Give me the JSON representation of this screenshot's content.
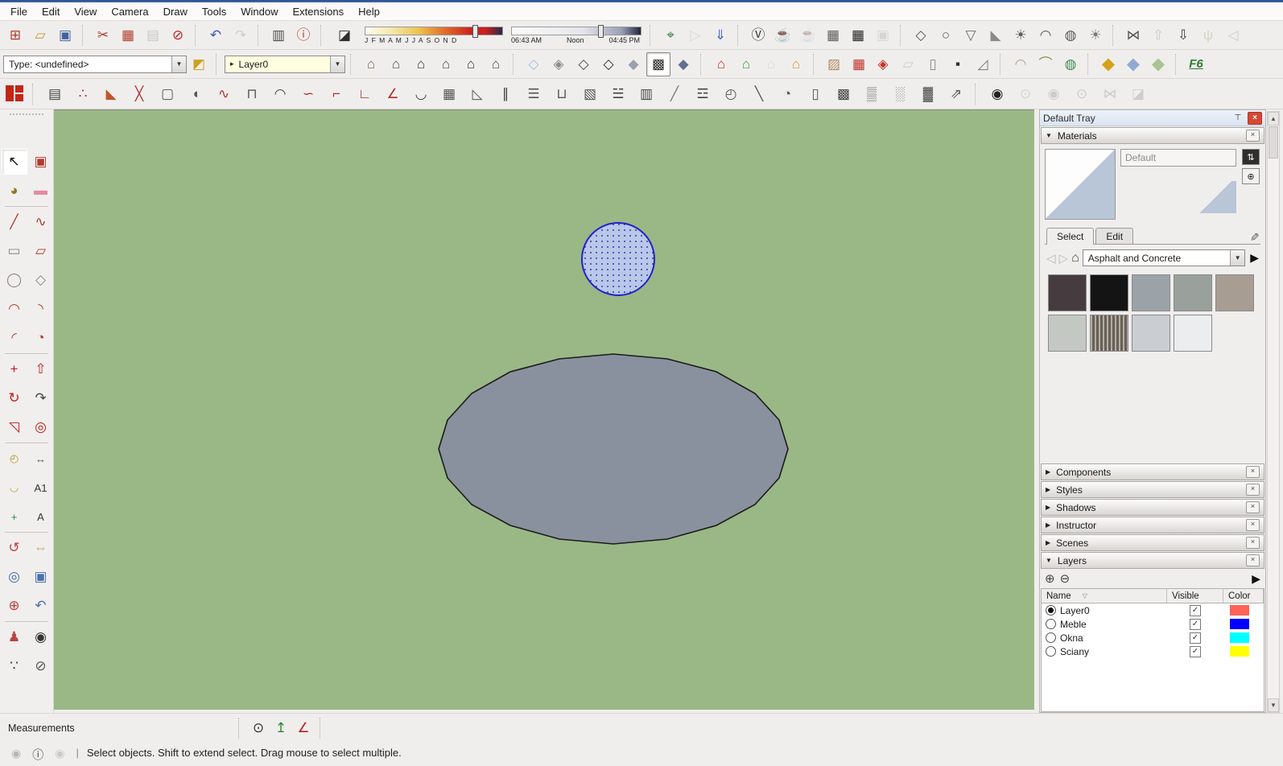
{
  "menu": {
    "items": [
      {
        "label": "File",
        "name": "menu-file"
      },
      {
        "label": "Edit",
        "name": "menu-edit"
      },
      {
        "label": "View",
        "name": "menu-view"
      },
      {
        "label": "Camera",
        "name": "menu-camera"
      },
      {
        "label": "Draw",
        "name": "menu-draw"
      },
      {
        "label": "Tools",
        "name": "menu-tools"
      },
      {
        "label": "Window",
        "name": "menu-window"
      },
      {
        "label": "Extensions",
        "name": "menu-extensions"
      },
      {
        "label": "Help",
        "name": "menu-help"
      }
    ]
  },
  "toolbars": {
    "row1": {
      "g1": [
        {
          "name": "new-button",
          "glyph": "⊞",
          "color": "#b23a2e"
        },
        {
          "name": "open-button",
          "glyph": "▱",
          "color": "#c89a2a"
        },
        {
          "name": "save-button",
          "glyph": "▣",
          "color": "#44639e"
        }
      ],
      "g2": [
        {
          "name": "cut-button",
          "glyph": "✂",
          "color": "#b23a2e"
        },
        {
          "name": "copy-button",
          "glyph": "▦",
          "color": "#b23a2e"
        },
        {
          "name": "paste-button",
          "glyph": "▤",
          "color": "#8a8a8a",
          "faded": true
        },
        {
          "name": "erase-button",
          "glyph": "⊘",
          "color": "#c41f1f"
        }
      ],
      "g3": [
        {
          "name": "undo-button",
          "glyph": "↶",
          "color": "#3b5fc0"
        },
        {
          "name": "redo-button",
          "glyph": "↷",
          "color": "#9a9a9a",
          "faded": true
        }
      ],
      "g4": [
        {
          "name": "print-button",
          "glyph": "▥",
          "color": "#4a4a4a"
        },
        {
          "name": "model-info-button",
          "glyph": "ⓘ",
          "color": "#b23a2e"
        }
      ],
      "shadows": {
        "toggle_name": "toggle-shadows-button",
        "months": "J F M A M J J A S O N D",
        "time_start": "06:43 AM",
        "time_mid": "Noon",
        "time_end": "04:45 PM"
      },
      "g6": [
        {
          "name": "add-location-button",
          "glyph": "⌖",
          "color": "#3e7d3e"
        },
        {
          "name": "toggle-terrain-button",
          "glyph": "▷",
          "color": "#b3b3b3",
          "faded": true
        },
        {
          "name": "add-building-button",
          "glyph": "⇓",
          "color": "#3a6ac8"
        }
      ],
      "g7": [
        {
          "name": "vray-render-button",
          "glyph": "Ⓥ",
          "color": "#3c3c3c"
        },
        {
          "name": "vray-asset-editor-button",
          "glyph": "☕",
          "color": "#3c3c3c"
        },
        {
          "name": "vray-interactive-button",
          "glyph": "☕",
          "color": "#adadad",
          "faded": true
        },
        {
          "name": "vray-frame-buffer-button",
          "glyph": "▦",
          "color": "#5a5a5a"
        },
        {
          "name": "vray-batch-render-button",
          "glyph": "▦",
          "color": "#1e1e1e"
        },
        {
          "name": "vray-lock-camera-button",
          "glyph": "▣",
          "color": "#b0b0b0",
          "faded": true
        }
      ],
      "g8": [
        {
          "name": "vray-rectangle-light-button",
          "glyph": "◇",
          "color": "#565656"
        },
        {
          "name": "vray-sphere-light-button",
          "glyph": "○",
          "color": "#565656"
        },
        {
          "name": "vray-spot-light-button",
          "glyph": "▽",
          "color": "#6a6a6a"
        },
        {
          "name": "vray-ies-light-button",
          "glyph": "◣",
          "color": "#8a8a8a"
        },
        {
          "name": "vray-omni-light-button",
          "glyph": "☀",
          "color": "#5a5a5a"
        },
        {
          "name": "vray-dome-light-button",
          "glyph": "◠",
          "color": "#565656"
        },
        {
          "name": "vray-mesh-light-button",
          "glyph": "◍",
          "color": "#5a5a5a"
        },
        {
          "name": "vray-ambient-light-button",
          "glyph": "☀",
          "color": "#7a7a7a"
        }
      ],
      "g9": [
        {
          "name": "vray-infinite-plane-button",
          "glyph": "⋈",
          "color": "#555555"
        },
        {
          "name": "vray-import-proxy-button",
          "glyph": "⇧",
          "color": "#9a9a9a",
          "faded": true
        },
        {
          "name": "vray-export-proxy-button",
          "glyph": "⇩",
          "color": "#3e3e3e"
        },
        {
          "name": "vray-fur-button",
          "glyph": "ψ",
          "color": "#9fb387",
          "faded": true
        },
        {
          "name": "vray-clipper-button",
          "glyph": "◁",
          "color": "#9a9a9a",
          "faded": true
        }
      ]
    },
    "row2": {
      "type_combo": "Type: <undefined>",
      "tag_icon_name": "entity-tags-icon",
      "layer_combo": "Layer0",
      "views": [
        {
          "name": "view-iso-button",
          "glyph": "⌂",
          "color": "#7b6347"
        },
        {
          "name": "view-top-button",
          "glyph": "⌂",
          "color": "#4a4a4a"
        },
        {
          "name": "view-front-button",
          "glyph": "⌂",
          "color": "#333333"
        },
        {
          "name": "view-right-button",
          "glyph": "⌂",
          "color": "#4a4a4a"
        },
        {
          "name": "view-back-button",
          "glyph": "⌂",
          "color": "#333333"
        },
        {
          "name": "view-left-button",
          "glyph": "⌂",
          "color": "#4a4a4a"
        }
      ],
      "styles": [
        {
          "name": "style-xray-button",
          "glyph": "◇",
          "color": "#9cc3e0"
        },
        {
          "name": "style-back-edges-button",
          "glyph": "◈",
          "color": "#8a8a8a"
        },
        {
          "name": "style-wireframe-button",
          "glyph": "◇",
          "color": "#4a4a4a"
        },
        {
          "name": "style-hidden-line-button",
          "glyph": "◇",
          "color": "#2e2e2e"
        },
        {
          "name": "style-shaded-button",
          "glyph": "◆",
          "color": "#98a1ac"
        },
        {
          "name": "style-shaded-textures-button",
          "glyph": "▩",
          "color": "#2b2b2b",
          "pressed": true
        },
        {
          "name": "style-monochrome-button",
          "glyph": "◆",
          "color": "#5f7090"
        }
      ],
      "extA": [
        {
          "name": "house-builder-button",
          "glyph": "⌂",
          "color": "#c03028"
        },
        {
          "name": "house-update-button",
          "glyph": "⌂",
          "color": "#3f9b3f"
        },
        {
          "name": "house-sync-button",
          "glyph": "⌂",
          "color": "#b8b8b8",
          "faded": true
        },
        {
          "name": "house-report-button",
          "glyph": "⌂",
          "color": "#cf9f1f"
        }
      ],
      "extB": [
        {
          "name": "texture-plane-button",
          "glyph": "▨",
          "color": "#b08a60"
        },
        {
          "name": "grid-tool-button",
          "glyph": "▦",
          "color": "#c03028"
        }
      ],
      "extC": [
        {
          "name": "flip-tool-button",
          "glyph": "◈",
          "color": "#c03028"
        },
        {
          "name": "crumple-tool-button",
          "glyph": "▱",
          "color": "#9a9a9a",
          "faded": true
        },
        {
          "name": "ghost-tool-button",
          "glyph": "▯",
          "color": "#8a8a8a"
        },
        {
          "name": "shadow-box-button",
          "glyph": "▪",
          "color": "#2f2f2f"
        },
        {
          "name": "slice-tool-button",
          "glyph": "◿",
          "color": "#777777"
        }
      ],
      "extD": [
        {
          "name": "shell-tool-button",
          "glyph": "◠",
          "color": "#ada282"
        },
        {
          "name": "curve-box-button",
          "glyph": "⌒",
          "color": "#7d9b3f"
        },
        {
          "name": "geodesic-tool-button",
          "glyph": "◍",
          "color": "#3f8f55"
        }
      ],
      "cubes": [
        {
          "name": "cube-yellow-button",
          "glyph": "◆",
          "color": "#d5a21b"
        },
        {
          "name": "cube-blue-button",
          "glyph": "◆",
          "color": "#92a9d4"
        },
        {
          "name": "cube-green-button",
          "glyph": "◆",
          "color": "#a9c492"
        }
      ],
      "f6_label": "F6"
    },
    "row3": {
      "bit": [
        {
          "name": "wall-panel-tool",
          "glyph": "▤",
          "color": "#3f3f3f"
        },
        {
          "name": "bead-chain-tool",
          "glyph": "∴",
          "color": "#b03030"
        },
        {
          "name": "roof-pyramid-tool",
          "glyph": "◣",
          "color": "#c0552a"
        },
        {
          "name": "cut-cross-tool",
          "glyph": "╳",
          "color": "#b03030"
        },
        {
          "name": "dashed-face-tool",
          "glyph": "▢",
          "color": "#555555"
        },
        {
          "name": "extrude-tool",
          "glyph": "◖",
          "color": "#555555"
        },
        {
          "name": "curl-tool",
          "glyph": "∿",
          "color": "#b03030"
        },
        {
          "name": "frame-box-tool",
          "glyph": "⊓",
          "color": "#555555"
        },
        {
          "name": "dome-tool",
          "glyph": "◠",
          "color": "#444444"
        },
        {
          "name": "hook-tool",
          "glyph": "∽",
          "color": "#b03030"
        },
        {
          "name": "corner-a-tool",
          "glyph": "⌐",
          "color": "#b03030"
        },
        {
          "name": "corner-b-tool",
          "glyph": "∟",
          "color": "#b03030"
        },
        {
          "name": "angle-tool",
          "glyph": "∠",
          "color": "#b03030"
        },
        {
          "name": "arc-profile-tool",
          "glyph": "◡",
          "color": "#444444"
        },
        {
          "name": "cage-tool",
          "glyph": "▦",
          "color": "#555555"
        },
        {
          "name": "wedge-tool",
          "glyph": "◺",
          "color": "#555555"
        },
        {
          "name": "column-tool",
          "glyph": "∥",
          "color": "#444444"
        },
        {
          "name": "fence-tool",
          "glyph": "☰",
          "color": "#555555"
        },
        {
          "name": "grab-frame-tool",
          "glyph": "⊔",
          "color": "#555555"
        },
        {
          "name": "fold-tool",
          "glyph": "▧",
          "color": "#555555"
        },
        {
          "name": "louvre-tool",
          "glyph": "☱",
          "color": "#444444"
        },
        {
          "name": "shelf-tool",
          "glyph": "▥",
          "color": "#444444"
        },
        {
          "name": "plank-tool",
          "glyph": "╱",
          "color": "#777777"
        },
        {
          "name": "stairs-tool",
          "glyph": "☲",
          "color": "#444444"
        },
        {
          "name": "spiral-stairs-tool",
          "glyph": "◴",
          "color": "#555555"
        },
        {
          "name": "ramp-tool",
          "glyph": "╲",
          "color": "#555555"
        },
        {
          "name": "window-fan-tool",
          "glyph": "◔",
          "color": "#555555"
        },
        {
          "name": "door-frame-tool",
          "glyph": "▯",
          "color": "#555555"
        },
        {
          "name": "grille-tool",
          "glyph": "▩",
          "color": "#444444"
        },
        {
          "name": "weave-tool",
          "glyph": "▒",
          "color": "#666666"
        },
        {
          "name": "curtain-tool",
          "glyph": "░",
          "color": "#777777"
        },
        {
          "name": "thatch-tool",
          "glyph": "▓",
          "color": "#555555"
        },
        {
          "name": "export-arrow-tool",
          "glyph": "⇗",
          "color": "#555555"
        }
      ],
      "cams": [
        {
          "name": "add-camera-button",
          "glyph": "◉",
          "color": "#222222"
        },
        {
          "name": "render-disc-button",
          "glyph": "⊙",
          "color": "#b0b0b0",
          "faded": true
        },
        {
          "name": "camera-pair-button",
          "glyph": "◉",
          "color": "#9a9a9a",
          "faded": true
        },
        {
          "name": "video-camera-button",
          "glyph": "⊙",
          "color": "#9a9a9a",
          "faded": true
        },
        {
          "name": "kite-wire-button",
          "glyph": "⋈",
          "color": "#9a9a9a",
          "faded": true
        },
        {
          "name": "kite-solid-button",
          "glyph": "◪",
          "color": "#9a9a9a",
          "faded": true
        }
      ]
    }
  },
  "left_tools": {
    "gA": [
      {
        "name": "select-tool",
        "glyph": "↖",
        "color": "#111111",
        "pressed": true
      },
      {
        "name": "make-component-tool",
        "glyph": "▣",
        "color": "#b23a2e"
      },
      {
        "name": "paint-bucket-tool",
        "glyph": "◕",
        "color": "#8a7a2a"
      },
      {
        "name": "eraser-tool",
        "glyph": "▬",
        "color": "#e58aa0"
      }
    ],
    "gB": [
      {
        "name": "line-tool",
        "glyph": "╱",
        "color": "#b23a2e"
      },
      {
        "name": "freehand-tool",
        "glyph": "∿",
        "color": "#b23a2e"
      },
      {
        "name": "rectangle-tool",
        "glyph": "▭",
        "color": "#8a8878"
      },
      {
        "name": "rotated-rectangle-tool",
        "glyph": "▱",
        "color": "#b23a2e"
      },
      {
        "name": "circle-tool",
        "glyph": "◯",
        "color": "#8a8878"
      },
      {
        "name": "polygon-tool",
        "glyph": "◇",
        "color": "#8a8878"
      },
      {
        "name": "arc-tool",
        "glyph": "◠",
        "color": "#b23a2e"
      },
      {
        "name": "two-point-arc-tool",
        "glyph": "◝",
        "color": "#b23a2e"
      },
      {
        "name": "three-point-arc-tool",
        "glyph": "◜",
        "color": "#b23a2e"
      },
      {
        "name": "pie-tool",
        "glyph": "◔",
        "color": "#b23a2e"
      }
    ],
    "gC": [
      {
        "name": "move-tool",
        "glyph": "+",
        "color": "#c02020"
      },
      {
        "name": "push-pull-tool",
        "glyph": "⇧",
        "color": "#c02020"
      },
      {
        "name": "rotate-tool",
        "glyph": "↻",
        "color": "#c02020"
      },
      {
        "name": "follow-me-tool",
        "glyph": "↷",
        "color": "#444444"
      },
      {
        "name": "scale-tool",
        "glyph": "◹",
        "color": "#c02020"
      },
      {
        "name": "offset-tool",
        "glyph": "◎",
        "color": "#c02020"
      }
    ],
    "gD": [
      {
        "name": "tape-measure-tool",
        "glyph": "◴",
        "color": "#b09a20"
      },
      {
        "name": "dimension-tool",
        "glyph": "↔",
        "color": "#44556a"
      },
      {
        "name": "protractor-tool",
        "glyph": "◡",
        "color": "#b09a20"
      },
      {
        "name": "text-tool",
        "glyph": "A1",
        "color": "#333333"
      },
      {
        "name": "axes-tool",
        "glyph": "+",
        "color": "#2a8a4a"
      },
      {
        "name": "3d-text-tool",
        "glyph": "A",
        "color": "#333333"
      }
    ],
    "gE": [
      {
        "name": "orbit-tool",
        "glyph": "↺",
        "color": "#c04040"
      },
      {
        "name": "pan-tool",
        "glyph": "⇔",
        "color": "#caa36a"
      },
      {
        "name": "zoom-tool",
        "glyph": "◎",
        "color": "#4a6fae"
      },
      {
        "name": "zoom-window-tool",
        "glyph": "▣",
        "color": "#4a6fae"
      },
      {
        "name": "zoom-extents-tool",
        "glyph": "⊕",
        "color": "#c04040"
      },
      {
        "name": "previous-view-tool",
        "glyph": "↶",
        "color": "#4a6fae"
      }
    ],
    "gF": [
      {
        "name": "position-camera-tool",
        "glyph": "♟",
        "color": "#c04040"
      },
      {
        "name": "look-around-tool",
        "glyph": "◉",
        "color": "#333333"
      },
      {
        "name": "walk-tool",
        "glyph": "∵",
        "color": "#333333"
      },
      {
        "name": "section-plane-tool",
        "glyph": "⊘",
        "color": "#555555"
      }
    ]
  },
  "canvas": {
    "background": "#9ab885",
    "shapes": [
      {
        "type": "circle",
        "state": "selected",
        "fill": "#b9c7e9",
        "stroke": "#2121cd"
      },
      {
        "type": "ellipse",
        "fill": "#8a919e",
        "stroke": "#1b1b1b"
      }
    ]
  },
  "tray": {
    "title": "Default Tray",
    "materials": {
      "title": "Materials",
      "name_field": "Default",
      "tabs": {
        "select": "Select",
        "edit": "Edit"
      },
      "collection": "Asphalt and Concrete",
      "swatches": [
        {
          "name": "swatch-asphalt-dark",
          "color": "#463c40"
        },
        {
          "name": "swatch-asphalt-black",
          "color": "#141414"
        },
        {
          "name": "swatch-concrete-gray",
          "color": "#9ba3a9"
        },
        {
          "name": "swatch-concrete-aggregate",
          "color": "#9aa09b"
        },
        {
          "name": "swatch-gravel",
          "color": "#a79d92"
        },
        {
          "name": "swatch-concrete-light",
          "color": "#c4c8c3"
        },
        {
          "name": "swatch-concrete-formboard",
          "color": "#8b8174",
          "striped": true
        },
        {
          "name": "swatch-concrete-smooth",
          "color": "#caced2"
        },
        {
          "name": "swatch-concrete-white",
          "color": "#ebedee"
        }
      ]
    },
    "panels": [
      {
        "label": "Components",
        "name": "panel-components-header"
      },
      {
        "label": "Styles",
        "name": "panel-styles-header"
      },
      {
        "label": "Shadows",
        "name": "panel-shadows-header"
      },
      {
        "label": "Instructor",
        "name": "panel-instructor-header"
      },
      {
        "label": "Scenes",
        "name": "panel-scenes-header"
      }
    ],
    "layers": {
      "title": "Layers",
      "columns": {
        "name": "Name",
        "visible": "Visible",
        "color": "Color"
      },
      "rows": [
        {
          "name": "Layer0",
          "selected": true,
          "visible": "✓",
          "color": "#ff6257"
        },
        {
          "name": "Meble",
          "selected": false,
          "visible": "✓",
          "color": "#0000fe"
        },
        {
          "name": "Okna",
          "selected": false,
          "visible": "✓",
          "color": "#00ffff"
        },
        {
          "name": "Sciany",
          "selected": false,
          "visible": "✓",
          "color": "#ffff00"
        }
      ]
    }
  },
  "statusbar": {
    "measurements_label": "Measurements",
    "hint": "Select objects. Shift to extend select. Drag mouse to select multiple."
  }
}
